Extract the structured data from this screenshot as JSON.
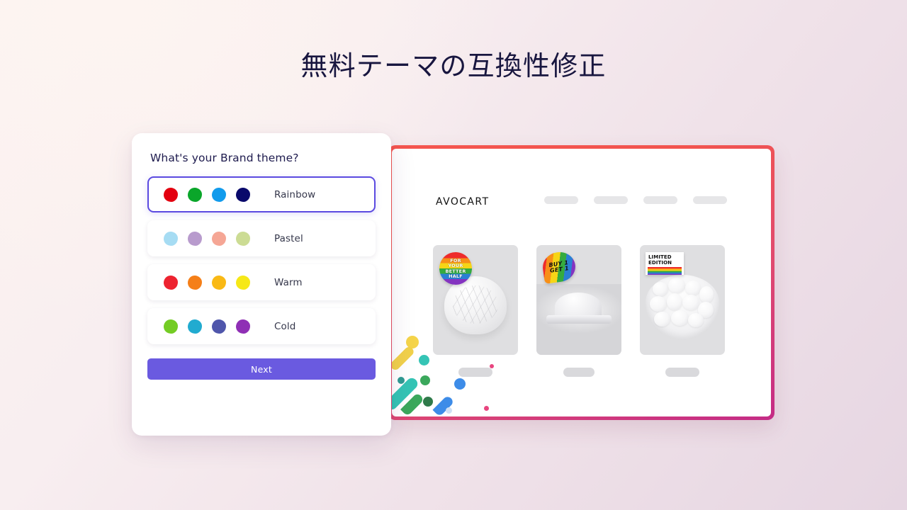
{
  "page": {
    "title": "無料テーマの互換性修正",
    "background_from": "#fcf3f1",
    "background_to": "#e6d6e2",
    "title_color": "#18163f"
  },
  "theme_card": {
    "heading": "What's your Brand theme?",
    "accent_color": "#5b4ae0",
    "options": [
      {
        "label": "Rainbow",
        "selected": true,
        "colors": [
          "#e3000f",
          "#0aa62a",
          "#129bec",
          "#09096b"
        ]
      },
      {
        "label": "Pastel",
        "selected": false,
        "colors": [
          "#a6dcf3",
          "#b89bcd",
          "#f5a695",
          "#ccdc94"
        ]
      },
      {
        "label": "Warm",
        "selected": false,
        "colors": [
          "#ed2330",
          "#f57f18",
          "#f9b915",
          "#f6e817"
        ]
      },
      {
        "label": "Cold",
        "selected": false,
        "colors": [
          "#74cc24",
          "#21abd0",
          "#4f56ab",
          "#8f2fb5"
        ]
      }
    ],
    "next_label": "Next"
  },
  "store_preview": {
    "frame_gradient_from": "#f4554f",
    "frame_gradient_to": "#c42c86",
    "logo": "Avocart",
    "nav_pills": 4,
    "products": [
      {
        "badge_type": "rainbow-circle",
        "badge_lines": [
          "FOR",
          "YOUR",
          "BETTER",
          "HALF"
        ],
        "image_alt": "bread-loaf"
      },
      {
        "badge_type": "rainbow-bubble",
        "badge_lines": [
          "BUY 1",
          "GET 1"
        ],
        "image_alt": "burger"
      },
      {
        "badge_type": "limited-edition-box",
        "badge_lines": [
          "LIMITED",
          "EDITION"
        ],
        "image_alt": "egg-bowl"
      }
    ],
    "confetti_colors": [
      "#f5d44a",
      "#35c4b5",
      "#3ba85c",
      "#3d8ce8",
      "#2aa8a0",
      "#4ec47a"
    ]
  }
}
